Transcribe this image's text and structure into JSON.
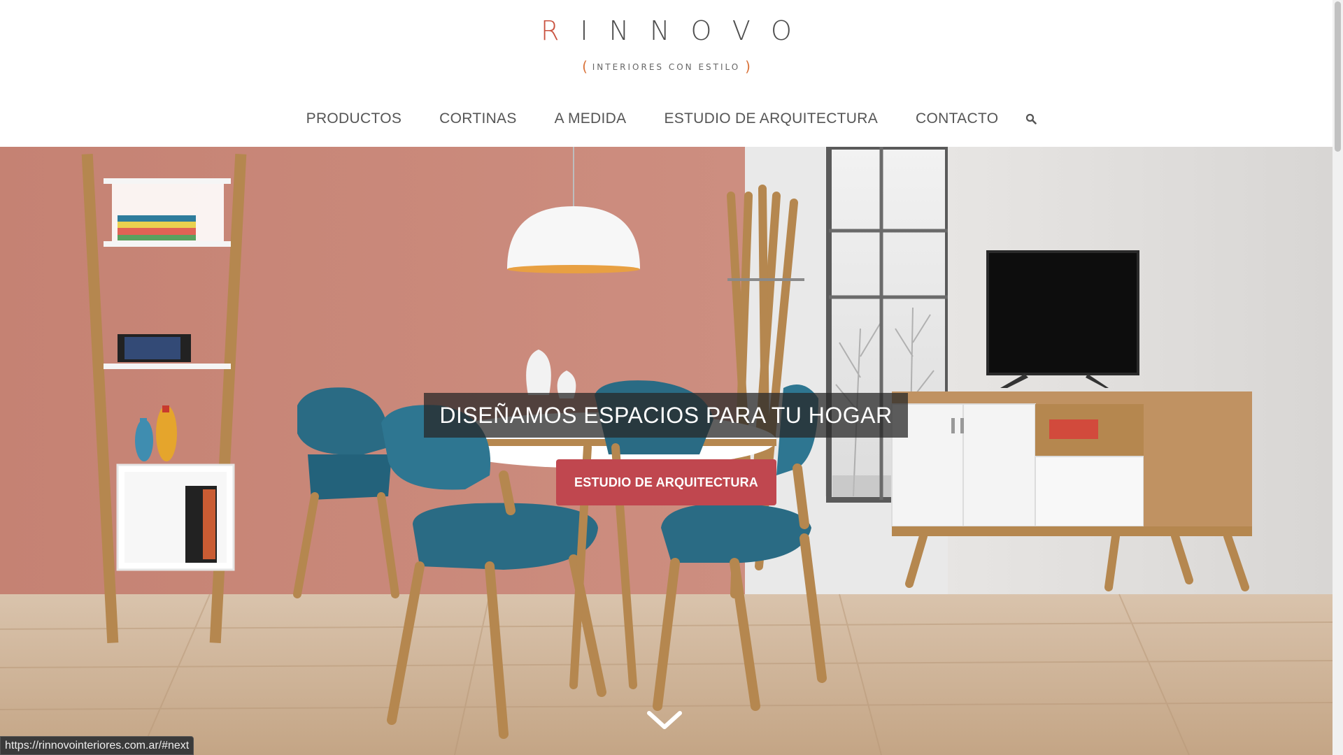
{
  "logo": {
    "r_letter": "R",
    "rest": "INNOVO",
    "paren_open": "(",
    "tagline": "INTERIORES CON ESTILO",
    "paren_close": ")"
  },
  "nav": {
    "items": [
      {
        "label": "PRODUCTOS"
      },
      {
        "label": "CORTINAS"
      },
      {
        "label": "A MEDIDA"
      },
      {
        "label": "ESTUDIO DE ARQUITECTURA"
      },
      {
        "label": "CONTACTO"
      }
    ],
    "search_icon": "search-icon"
  },
  "hero": {
    "headline": "DISEÑAMOS ESPACIOS PARA TU HOGAR",
    "cta_label": "ESTUDIO DE ARQUITECTURA",
    "scroll_icon": "chevron-down-icon"
  },
  "status_bar": {
    "url": "https://rinnovointeriores.com.ar/#next"
  },
  "colors": {
    "accent": "#c0474f",
    "logo_r": "#c9523f",
    "wall": "#c98476",
    "teal_chair": "#2a6b84",
    "wood": "#b98a56"
  }
}
